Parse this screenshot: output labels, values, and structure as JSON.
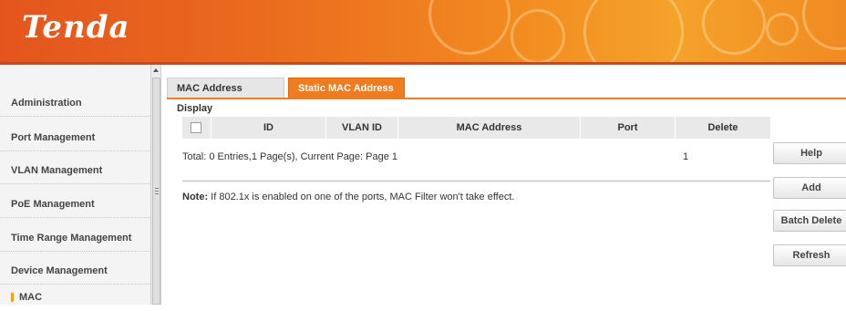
{
  "header": {
    "logo_text": "Tenda"
  },
  "sidebar": {
    "items": [
      {
        "label": "Administration"
      },
      {
        "label": "Port Management"
      },
      {
        "label": "VLAN Management"
      },
      {
        "label": "PoE Management"
      },
      {
        "label": "Time Range Management"
      },
      {
        "label": "Device Management"
      },
      {
        "label": "MAC"
      }
    ]
  },
  "tabs": [
    {
      "label": "MAC Address Display"
    },
    {
      "label": "Static MAC Address"
    }
  ],
  "table": {
    "columns": [
      "ID",
      "VLAN ID",
      "MAC Address",
      "Port",
      "Delete"
    ],
    "total_text": "Total: 0 Entries,1 Page(s), Current Page: Page 1",
    "page_number": "1"
  },
  "note": {
    "prefix": "Note:",
    "text": " If 802.1x is enabled on one of the ports, MAC Filter won't take effect."
  },
  "buttons": {
    "help": "Help",
    "add": "Add",
    "batch_delete": "Batch Delete",
    "refresh": "Refresh"
  },
  "colors": {
    "accent": "#f07c20",
    "header_start": "#e4551d",
    "header_end": "#f5a22a"
  }
}
